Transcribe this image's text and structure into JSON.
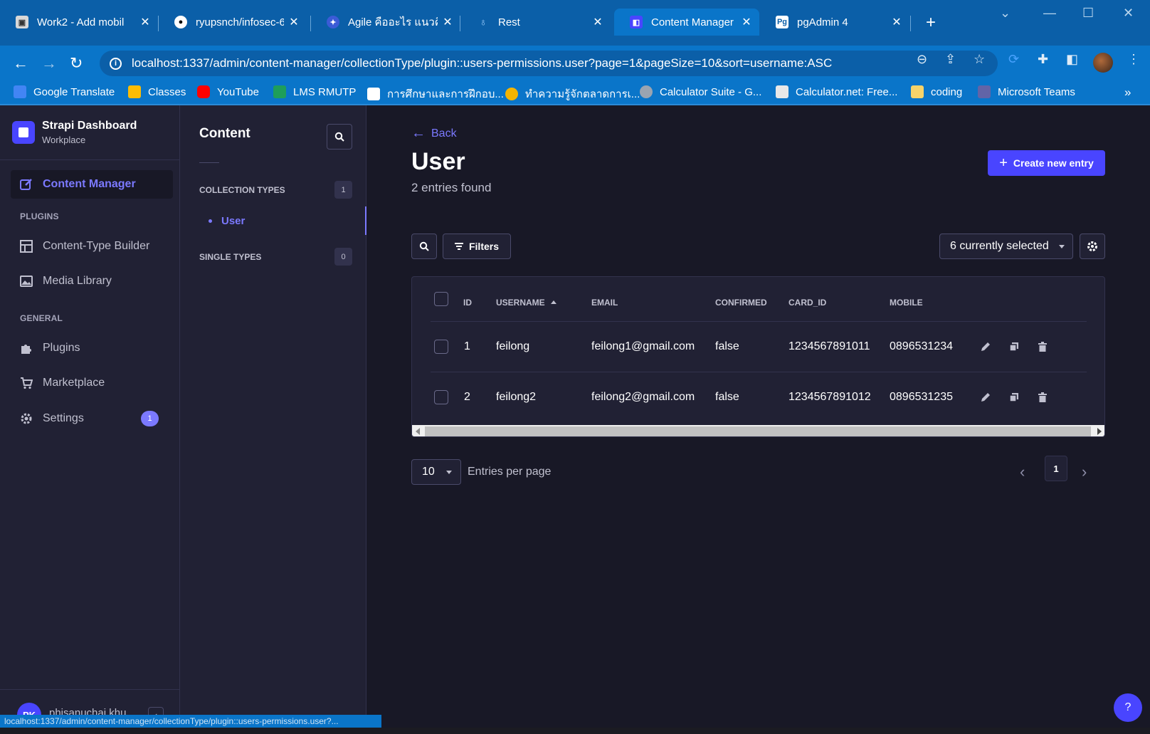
{
  "browser": {
    "tabs": [
      {
        "title": "Work2 - Add mobil",
        "close": "✕",
        "fav_color": "#4b4b4b"
      },
      {
        "title": "ryupsnch/infosec-6",
        "close": "✕",
        "fav_color": "#0b5fa8"
      },
      {
        "title": "Agile คืออะไร แนวคิด",
        "close": "✕",
        "fav_color": "#3b5bd6"
      },
      {
        "title": "Rest",
        "close": "✕",
        "fav_color": "#0b5fa8"
      },
      {
        "title": "Content Manager",
        "close": "✕",
        "fav_color": "#4945ff"
      },
      {
        "title": "pgAdmin 4",
        "close": "✕",
        "fav_color": "#0b5fa8"
      }
    ],
    "new_tab": "+",
    "url": "localhost:1337/admin/content-manager/collectionType/plugin::users-permissions.user?page=1&pageSize=10&sort=username:ASC",
    "bookmarks": [
      {
        "label": "Google Translate",
        "color": "#4285f4"
      },
      {
        "label": "Classes",
        "color": "#fbbc04"
      },
      {
        "label": "YouTube",
        "color": "#ff0000"
      },
      {
        "label": "LMS RMUTP",
        "color": "#1e9e5a"
      },
      {
        "label": "การศึกษาและการฝึกอบ...",
        "color": "#ffffff"
      },
      {
        "label": "ทำความรู้จักตลาดการเ...",
        "color": "#f4b400"
      },
      {
        "label": "Calculator Suite - G...",
        "color": "#9aa4b1"
      },
      {
        "label": "Calculator.net: Free...",
        "color": "#e8e8e8"
      },
      {
        "label": "coding",
        "color": "#f6d36a"
      },
      {
        "label": "Microsoft Teams",
        "color": "#6264a7"
      }
    ],
    "more": "»",
    "status_url": "localhost:1337/admin/content-manager/collectionType/plugin::users-permissions.user?..."
  },
  "mainnav": {
    "brand_title": "Strapi Dashboard",
    "brand_sub": "Workplace",
    "content_manager": "Content Manager",
    "plugins_heading": "PLUGINS",
    "ctb": "Content-Type Builder",
    "media": "Media Library",
    "general_heading": "GENERAL",
    "plugins": "Plugins",
    "marketplace": "Marketplace",
    "settings": "Settings",
    "settings_badge": "1",
    "user_initials": "PK",
    "user_name": "phisanuchai khu..."
  },
  "subnav": {
    "title": "Content",
    "collection_types": "COLLECTION TYPES",
    "collection_count": "1",
    "user_link": "User",
    "single_types": "SINGLE TYPES",
    "single_count": "0"
  },
  "main": {
    "back": "Back",
    "title": "User",
    "subtitle": "2 entries found",
    "create": "Create new entry",
    "filters": "Filters",
    "columns_selected": "6 currently selected",
    "headers": {
      "id": "ID",
      "username": "USERNAME",
      "email": "EMAIL",
      "confirmed": "CONFIRMED",
      "card_id": "CARD_ID",
      "mobile": "MOBILE"
    },
    "rows": [
      {
        "id": "1",
        "username": "feilong",
        "email": "feilong1@gmail.com",
        "confirmed": "false",
        "card_id": "1234567891011",
        "mobile": "0896531234"
      },
      {
        "id": "2",
        "username": "feilong2",
        "email": "feilong2@gmail.com",
        "confirmed": "false",
        "card_id": "1234567891012",
        "mobile": "0896531235"
      }
    ],
    "page_size": "10",
    "entries_per_page": "Entries per page",
    "current_page": "1",
    "help": "?"
  },
  "colors": {
    "primary": "#4945ff",
    "primary_light": "#7b79ff",
    "browser_blue": "#0a75c9"
  }
}
